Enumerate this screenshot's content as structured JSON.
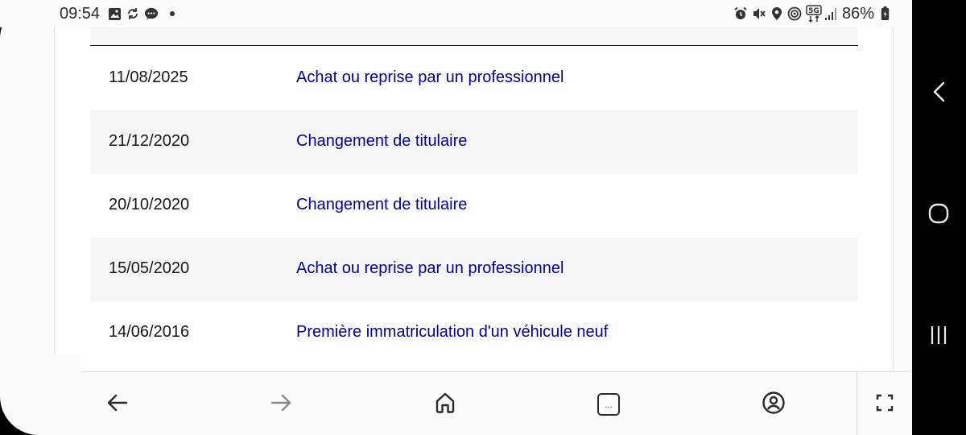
{
  "status_bar": {
    "time": "09:54",
    "battery_percent": "86%",
    "left_icons": [
      "gallery-icon",
      "sync-icon",
      "message-icon",
      "dot-icon"
    ],
    "right_icons": [
      "alarm-icon",
      "mute-icon",
      "location-icon",
      "hotspot-icon",
      "5g-icon",
      "signal-icon",
      "battery-icon"
    ],
    "network_label": "5G"
  },
  "history": {
    "rows": [
      {
        "date": "11/08/2025",
        "event": "Achat ou reprise par un professionnel"
      },
      {
        "date": "21/12/2020",
        "event": "Changement de titulaire"
      },
      {
        "date": "20/10/2020",
        "event": "Changement de titulaire"
      },
      {
        "date": "15/05/2020",
        "event": "Achat ou reprise par un professionnel"
      },
      {
        "date": "14/06/2016",
        "event": "Première immatriculation d'un véhicule neuf"
      }
    ]
  },
  "browser_bar": {
    "buttons": [
      "back-icon",
      "forward-icon",
      "home-icon",
      "tabs-icon",
      "account-icon",
      "fullscreen-icon"
    ],
    "tabs_label": "..."
  },
  "android_nav": [
    "recent-back-icon",
    "home-circle-icon",
    "recents-icon"
  ],
  "colors": {
    "link": "#000091",
    "text": "#161616",
    "row_alt": "#f6f6f6"
  }
}
